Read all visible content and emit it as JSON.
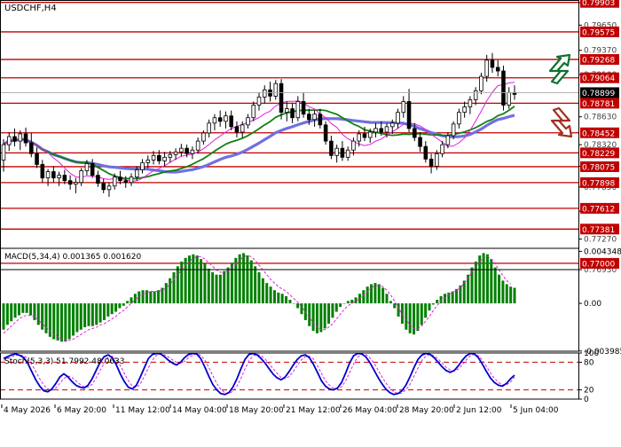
{
  "symbol": "USDCHF,H4",
  "colors": {
    "background": "#ffffff",
    "frame": "#000000",
    "level_line": "#c00000",
    "level_label_bg": "#c00000",
    "level_label_text": "#ffffff",
    "current_price_bg": "#000000",
    "current_price_text": "#ffffff",
    "ma_magenta": "#e020e0",
    "ma_green": "#108010",
    "ma_blue": "#7070e0",
    "macd_hist": "#008000",
    "macd_signal": "#e020e0",
    "stoch_main": "#0000cc",
    "stoch_signal": "#e020e0",
    "stoch_levels": "#c00000",
    "arrow_up": "#107030",
    "arrow_down": "#a03020"
  },
  "icons": {
    "up_arrow": "zigzag-up-arrow-icon",
    "down_arrow": "zigzag-down-arrow-icon"
  },
  "chart_data": [
    {
      "type": "candlestick",
      "title": "USDCHF,H4",
      "ylim": [
        0.7693,
        0.799
      ],
      "y_ticks_gray": [
        "0.79900",
        "0.79650",
        "0.79370",
        "0.79100",
        "0.78630",
        "0.78320",
        "0.78080",
        "0.77850",
        "0.77580",
        "0.77270",
        "0.76930"
      ],
      "levels": [
        "0.79903",
        "0.79575",
        "0.79268",
        "0.79064",
        "0.78781",
        "0.78452",
        "0.78229",
        "0.78075",
        "0.77898",
        "0.77612",
        "0.77381",
        "0.77000"
      ],
      "current_price": "0.78899",
      "x_labels": [
        "4 May 2026",
        "6 May 20:00",
        "11 May 12:00",
        "14 May 04:00",
        "18 May 20:00",
        "21 May 12:00",
        "26 May 04:00",
        "28 May 20:00",
        "2 Jun 12:00",
        "5 Jun 04:00"
      ],
      "candles": [
        [
          0.7815,
          0.7838,
          0.7802,
          0.7832
        ],
        [
          0.7832,
          0.7846,
          0.7825,
          0.7841
        ],
        [
          0.7841,
          0.785,
          0.783,
          0.7836
        ],
        [
          0.7836,
          0.7848,
          0.7826,
          0.7844
        ],
        [
          0.7844,
          0.7851,
          0.783,
          0.7834
        ],
        [
          0.7834,
          0.7845,
          0.7818,
          0.7822
        ],
        [
          0.7822,
          0.7829,
          0.7806,
          0.781
        ],
        [
          0.781,
          0.7815,
          0.779,
          0.7795
        ],
        [
          0.7795,
          0.7805,
          0.7786,
          0.7802
        ],
        [
          0.7802,
          0.7808,
          0.779,
          0.7795
        ],
        [
          0.7795,
          0.7802,
          0.7786,
          0.7798
        ],
        [
          0.7798,
          0.7804,
          0.7788,
          0.7792
        ],
        [
          0.7792,
          0.7798,
          0.7782,
          0.7788
        ],
        [
          0.7788,
          0.7795,
          0.7778,
          0.779
        ],
        [
          0.779,
          0.7806,
          0.7786,
          0.7803
        ],
        [
          0.7803,
          0.7815,
          0.7798,
          0.7811
        ],
        [
          0.7811,
          0.7816,
          0.7795,
          0.7798
        ],
        [
          0.7798,
          0.7803,
          0.7785,
          0.7789
        ],
        [
          0.7789,
          0.7794,
          0.7778,
          0.7782
        ],
        [
          0.7782,
          0.779,
          0.7774,
          0.7786
        ],
        [
          0.7786,
          0.78,
          0.7782,
          0.7796
        ],
        [
          0.7796,
          0.7803,
          0.7788,
          0.7792
        ],
        [
          0.7792,
          0.7797,
          0.7784,
          0.779
        ],
        [
          0.779,
          0.78,
          0.7786,
          0.7796
        ],
        [
          0.7796,
          0.7808,
          0.7792,
          0.7804
        ],
        [
          0.7804,
          0.7816,
          0.78,
          0.7812
        ],
        [
          0.7812,
          0.782,
          0.7806,
          0.7815
        ],
        [
          0.7815,
          0.7825,
          0.781,
          0.782
        ],
        [
          0.782,
          0.7826,
          0.781,
          0.7814
        ],
        [
          0.7814,
          0.7824,
          0.7808,
          0.7818
        ],
        [
          0.7818,
          0.7825,
          0.7812,
          0.7821
        ],
        [
          0.7821,
          0.7828,
          0.7815,
          0.7824
        ],
        [
          0.7824,
          0.7833,
          0.7819,
          0.7828
        ],
        [
          0.7828,
          0.7832,
          0.7818,
          0.7822
        ],
        [
          0.7822,
          0.783,
          0.7816,
          0.7826
        ],
        [
          0.7826,
          0.784,
          0.7822,
          0.7836
        ],
        [
          0.7836,
          0.7848,
          0.7832,
          0.7845
        ],
        [
          0.7845,
          0.786,
          0.784,
          0.7856
        ],
        [
          0.7856,
          0.7866,
          0.7848,
          0.7862
        ],
        [
          0.7862,
          0.787,
          0.7852,
          0.7858
        ],
        [
          0.7858,
          0.7869,
          0.785,
          0.7864
        ],
        [
          0.7864,
          0.787,
          0.7848,
          0.7852
        ],
        [
          0.7852,
          0.7858,
          0.784,
          0.7846
        ],
        [
          0.7846,
          0.7858,
          0.784,
          0.7854
        ],
        [
          0.7854,
          0.7866,
          0.785,
          0.7862
        ],
        [
          0.7862,
          0.788,
          0.7858,
          0.7876
        ],
        [
          0.7876,
          0.789,
          0.787,
          0.7885
        ],
        [
          0.7885,
          0.7898,
          0.7878,
          0.7893
        ],
        [
          0.7893,
          0.7902,
          0.788,
          0.7886
        ],
        [
          0.7886,
          0.7904,
          0.7882,
          0.79
        ],
        [
          0.79,
          0.7905,
          0.786,
          0.7868
        ],
        [
          0.7868,
          0.788,
          0.7858,
          0.7872
        ],
        [
          0.7872,
          0.7878,
          0.7856,
          0.7862
        ],
        [
          0.7862,
          0.7886,
          0.7858,
          0.788
        ],
        [
          0.788,
          0.789,
          0.7862,
          0.7866
        ],
        [
          0.7866,
          0.7872,
          0.7854,
          0.786
        ],
        [
          0.786,
          0.787,
          0.7852,
          0.7866
        ],
        [
          0.7866,
          0.7872,
          0.785,
          0.7854
        ],
        [
          0.7854,
          0.7858,
          0.7832,
          0.7836
        ],
        [
          0.7836,
          0.7842,
          0.7816,
          0.782
        ],
        [
          0.782,
          0.7832,
          0.7812,
          0.7828
        ],
        [
          0.7828,
          0.7836,
          0.7814,
          0.7818
        ],
        [
          0.7818,
          0.783,
          0.7814,
          0.7826
        ],
        [
          0.7826,
          0.784,
          0.782,
          0.7836
        ],
        [
          0.7836,
          0.7848,
          0.783,
          0.7844
        ],
        [
          0.7844,
          0.7852,
          0.7836,
          0.784
        ],
        [
          0.784,
          0.785,
          0.7834,
          0.7846
        ],
        [
          0.7846,
          0.7856,
          0.784,
          0.785
        ],
        [
          0.785,
          0.7858,
          0.7842,
          0.7846
        ],
        [
          0.7846,
          0.7856,
          0.784,
          0.7852
        ],
        [
          0.7852,
          0.786,
          0.7844,
          0.7856
        ],
        [
          0.7856,
          0.7872,
          0.785,
          0.7868
        ],
        [
          0.7868,
          0.7886,
          0.7862,
          0.788
        ],
        [
          0.788,
          0.7894,
          0.7846,
          0.785
        ],
        [
          0.785,
          0.7856,
          0.7836,
          0.784
        ],
        [
          0.784,
          0.7846,
          0.7824,
          0.783
        ],
        [
          0.783,
          0.7836,
          0.7812,
          0.7816
        ],
        [
          0.7816,
          0.7822,
          0.78,
          0.7808
        ],
        [
          0.7808,
          0.7826,
          0.7804,
          0.7822
        ],
        [
          0.7822,
          0.7836,
          0.7818,
          0.7832
        ],
        [
          0.7832,
          0.7846,
          0.7828,
          0.7842
        ],
        [
          0.7842,
          0.7858,
          0.7838,
          0.7855
        ],
        [
          0.7855,
          0.7872,
          0.785,
          0.7868
        ],
        [
          0.7868,
          0.788,
          0.7862,
          0.7874
        ],
        [
          0.7874,
          0.7886,
          0.7866,
          0.7882
        ],
        [
          0.7882,
          0.7896,
          0.7876,
          0.7892
        ],
        [
          0.7892,
          0.7912,
          0.7888,
          0.7908
        ],
        [
          0.7908,
          0.7932,
          0.7902,
          0.7926
        ],
        [
          0.7926,
          0.7934,
          0.7912,
          0.7918
        ],
        [
          0.7918,
          0.7926,
          0.7908,
          0.7914
        ],
        [
          0.7914,
          0.792,
          0.787,
          0.7876
        ],
        [
          0.7876,
          0.7896,
          0.7872,
          0.789
        ],
        [
          0.789,
          0.7898,
          0.7882,
          0.7888
        ]
      ]
    },
    {
      "type": "histogram",
      "title": "MACD(5,34,4) 0.001365 0.001620",
      "ylim": [
        -0.004,
        0.0046
      ],
      "y_ticks": [
        "0.004348",
        "0.00",
        "-0.003985"
      ],
      "histogram": [
        -0.0022,
        -0.0018,
        -0.0015,
        -0.0012,
        -0.001,
        -0.0008,
        -0.0008,
        -0.001,
        -0.0014,
        -0.0018,
        -0.0022,
        -0.0025,
        -0.0028,
        -0.003,
        -0.0031,
        -0.0032,
        -0.0032,
        -0.003,
        -0.0027,
        -0.0024,
        -0.0022,
        -0.002,
        -0.0019,
        -0.0019,
        -0.0018,
        -0.0016,
        -0.0014,
        -0.0011,
        -0.0009,
        -0.0007,
        -0.0004,
        -0.0002,
        0.0002,
        0.0005,
        0.0008,
        0.001,
        0.0011,
        0.0011,
        0.001,
        0.001,
        0.0011,
        0.0013,
        0.0017,
        0.0021,
        0.0026,
        0.0031,
        0.0035,
        0.0038,
        0.004,
        0.0041,
        0.004,
        0.0037,
        0.0033,
        0.0029,
        0.0026,
        0.0024,
        0.0024,
        0.0027,
        0.003,
        0.0034,
        0.0038,
        0.0041,
        0.0042,
        0.004,
        0.0036,
        0.0031,
        0.0026,
        0.0021,
        0.0017,
        0.0014,
        0.0011,
        0.0009,
        0.0008,
        0.0006,
        0.0003,
        0.0,
        -0.0004,
        -0.0009,
        -0.0014,
        -0.0019,
        -0.0023,
        -0.0025,
        -0.0024,
        -0.0021,
        -0.0017,
        -0.0012,
        -0.0007,
        -0.0003,
        0.0,
        0.0002,
        0.0003,
        0.0005,
        0.0008,
        0.0011,
        0.0014,
        0.0016,
        0.0017,
        0.0016,
        0.0013,
        0.0008,
        0.0002,
        -0.0004,
        -0.0011,
        -0.0017,
        -0.0022,
        -0.0025,
        -0.0026,
        -0.0023,
        -0.0018,
        -0.0012,
        -0.0006,
        -0.0001,
        0.0003,
        0.0006,
        0.0008,
        0.0009,
        0.001,
        0.0012,
        0.0015,
        0.0019,
        0.0024,
        0.003,
        0.0035,
        0.004,
        0.0042,
        0.0041,
        0.0037,
        0.003,
        0.0024,
        0.0019,
        0.0016,
        0.0014,
        0.0013
      ],
      "signal": [
        -0.0025,
        -0.0022,
        -0.0019,
        -0.0016,
        -0.0013,
        -0.0011,
        -0.001,
        -0.001,
        -0.0011,
        -0.0014,
        -0.0017,
        -0.002,
        -0.0023,
        -0.0026,
        -0.0028,
        -0.003,
        -0.0031,
        -0.0031,
        -0.003,
        -0.0028,
        -0.0026,
        -0.0024,
        -0.0022,
        -0.0021,
        -0.002,
        -0.0018,
        -0.0017,
        -0.0015,
        -0.0013,
        -0.0011,
        -0.0008,
        -0.0006,
        -0.0003,
        0.0,
        0.0003,
        0.0006,
        0.0008,
        0.0009,
        0.001,
        0.001,
        0.001,
        0.0011,
        0.0013,
        0.0016,
        0.002,
        0.0024,
        0.0028,
        0.0032,
        0.0035,
        0.0038,
        0.0039,
        0.0039,
        0.0037,
        0.0034,
        0.0031,
        0.0028,
        0.0026,
        0.0026,
        0.0027,
        0.003,
        0.0033,
        0.0036,
        0.0039,
        0.004,
        0.0039,
        0.0036,
        0.0032,
        0.0028,
        0.0024,
        0.002,
        0.0017,
        0.0014,
        0.0012,
        0.001,
        0.0007,
        0.0004,
        0.0001,
        -0.0003,
        -0.0007,
        -0.0012,
        -0.0016,
        -0.002,
        -0.0022,
        -0.0022,
        -0.002,
        -0.0017,
        -0.0013,
        -0.0009,
        -0.0005,
        -0.0002,
        0.0,
        0.0002,
        0.0004,
        0.0007,
        0.001,
        0.0013,
        0.0015,
        0.0015,
        0.0014,
        0.0011,
        0.0007,
        0.0002,
        -0.0004,
        -0.0009,
        -0.0014,
        -0.0018,
        -0.0021,
        -0.0021,
        -0.0019,
        -0.0015,
        -0.0011,
        -0.0006,
        -0.0002,
        0.0002,
        0.0005,
        0.0007,
        0.0009,
        0.0011,
        0.0013,
        0.0017,
        0.0021,
        0.0026,
        0.0031,
        0.0035,
        0.0038,
        0.0039,
        0.0037,
        0.0033,
        0.0028,
        0.0023,
        0.0019,
        0.0016
      ]
    },
    {
      "type": "line",
      "title": "Stoch(5,3,3) 51.7992 48.0633",
      "ylim": [
        0,
        100
      ],
      "y_ticks": [
        "100",
        "80",
        "20",
        "0"
      ],
      "levels": [
        80,
        20
      ],
      "series": [
        {
          "values": [
            88,
            92,
            96,
            98,
            95,
            90,
            78,
            60,
            42,
            28,
            18,
            16,
            22,
            34,
            48,
            55,
            48,
            38,
            30,
            26,
            24,
            30,
            44,
            62,
            80,
            92,
            96,
            90,
            75,
            55,
            38,
            26,
            22,
            30,
            48,
            68,
            88,
            97,
            99,
            98,
            92,
            84,
            78,
            74,
            80,
            90,
            97,
            99,
            98,
            88,
            70,
            50,
            32,
            20,
            12,
            10,
            14,
            26,
            44,
            66,
            86,
            97,
            99,
            96,
            88,
            78,
            66,
            54,
            46,
            42,
            48,
            60,
            74,
            86,
            94,
            96,
            90,
            76,
            58,
            40,
            28,
            22,
            20,
            24,
            36,
            56,
            78,
            94,
            99,
            98,
            92,
            80,
            64,
            48,
            34,
            22,
            14,
            10,
            12,
            18,
            30,
            48,
            68,
            86,
            96,
            99,
            97,
            90,
            80,
            70,
            62,
            58,
            62,
            72,
            84,
            94,
            99,
            98,
            90,
            76,
            60,
            46,
            36,
            30,
            28,
            34,
            44,
            52
          ]
        },
        {
          "values": [
            84,
            88,
            92,
            95,
            96,
            94,
            88,
            76,
            60,
            44,
            30,
            22,
            19,
            24,
            34,
            45,
            50,
            47,
            40,
            32,
            27,
            26,
            32,
            46,
            62,
            78,
            90,
            93,
            87,
            73,
            56,
            40,
            28,
            25,
            33,
            49,
            68,
            85,
            95,
            98,
            96,
            91,
            85,
            80,
            78,
            82,
            90,
            95,
            98,
            95,
            85,
            69,
            51,
            34,
            21,
            14,
            12,
            17,
            28,
            45,
            65,
            83,
            94,
            97,
            94,
            87,
            77,
            66,
            56,
            47,
            44,
            49,
            60,
            73,
            85,
            92,
            93,
            87,
            73,
            56,
            40,
            30,
            24,
            22,
            27,
            39,
            57,
            76,
            91,
            97,
            97,
            90,
            79,
            64,
            49,
            35,
            24,
            16,
            12,
            13,
            20,
            32,
            49,
            67,
            84,
            94,
            97,
            94,
            87,
            78,
            69,
            63,
            61,
            65,
            74,
            85,
            94,
            97,
            94,
            85,
            71,
            57,
            45,
            36,
            31,
            31,
            37,
            48
          ]
        }
      ]
    }
  ]
}
